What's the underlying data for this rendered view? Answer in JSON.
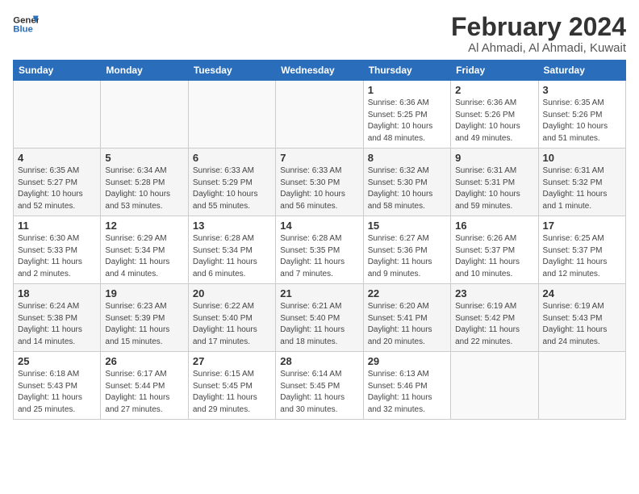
{
  "logo": {
    "line1": "General",
    "line2": "Blue"
  },
  "title": "February 2024",
  "location": "Al Ahmadi, Al Ahmadi, Kuwait",
  "days_of_week": [
    "Sunday",
    "Monday",
    "Tuesday",
    "Wednesday",
    "Thursday",
    "Friday",
    "Saturday"
  ],
  "weeks": [
    [
      {
        "day": "",
        "detail": ""
      },
      {
        "day": "",
        "detail": ""
      },
      {
        "day": "",
        "detail": ""
      },
      {
        "day": "",
        "detail": ""
      },
      {
        "day": "1",
        "detail": "Sunrise: 6:36 AM\nSunset: 5:25 PM\nDaylight: 10 hours\nand 48 minutes."
      },
      {
        "day": "2",
        "detail": "Sunrise: 6:36 AM\nSunset: 5:26 PM\nDaylight: 10 hours\nand 49 minutes."
      },
      {
        "day": "3",
        "detail": "Sunrise: 6:35 AM\nSunset: 5:26 PM\nDaylight: 10 hours\nand 51 minutes."
      }
    ],
    [
      {
        "day": "4",
        "detail": "Sunrise: 6:35 AM\nSunset: 5:27 PM\nDaylight: 10 hours\nand 52 minutes."
      },
      {
        "day": "5",
        "detail": "Sunrise: 6:34 AM\nSunset: 5:28 PM\nDaylight: 10 hours\nand 53 minutes."
      },
      {
        "day": "6",
        "detail": "Sunrise: 6:33 AM\nSunset: 5:29 PM\nDaylight: 10 hours\nand 55 minutes."
      },
      {
        "day": "7",
        "detail": "Sunrise: 6:33 AM\nSunset: 5:30 PM\nDaylight: 10 hours\nand 56 minutes."
      },
      {
        "day": "8",
        "detail": "Sunrise: 6:32 AM\nSunset: 5:30 PM\nDaylight: 10 hours\nand 58 minutes."
      },
      {
        "day": "9",
        "detail": "Sunrise: 6:31 AM\nSunset: 5:31 PM\nDaylight: 10 hours\nand 59 minutes."
      },
      {
        "day": "10",
        "detail": "Sunrise: 6:31 AM\nSunset: 5:32 PM\nDaylight: 11 hours\nand 1 minute."
      }
    ],
    [
      {
        "day": "11",
        "detail": "Sunrise: 6:30 AM\nSunset: 5:33 PM\nDaylight: 11 hours\nand 2 minutes."
      },
      {
        "day": "12",
        "detail": "Sunrise: 6:29 AM\nSunset: 5:34 PM\nDaylight: 11 hours\nand 4 minutes."
      },
      {
        "day": "13",
        "detail": "Sunrise: 6:28 AM\nSunset: 5:34 PM\nDaylight: 11 hours\nand 6 minutes."
      },
      {
        "day": "14",
        "detail": "Sunrise: 6:28 AM\nSunset: 5:35 PM\nDaylight: 11 hours\nand 7 minutes."
      },
      {
        "day": "15",
        "detail": "Sunrise: 6:27 AM\nSunset: 5:36 PM\nDaylight: 11 hours\nand 9 minutes."
      },
      {
        "day": "16",
        "detail": "Sunrise: 6:26 AM\nSunset: 5:37 PM\nDaylight: 11 hours\nand 10 minutes."
      },
      {
        "day": "17",
        "detail": "Sunrise: 6:25 AM\nSunset: 5:37 PM\nDaylight: 11 hours\nand 12 minutes."
      }
    ],
    [
      {
        "day": "18",
        "detail": "Sunrise: 6:24 AM\nSunset: 5:38 PM\nDaylight: 11 hours\nand 14 minutes."
      },
      {
        "day": "19",
        "detail": "Sunrise: 6:23 AM\nSunset: 5:39 PM\nDaylight: 11 hours\nand 15 minutes."
      },
      {
        "day": "20",
        "detail": "Sunrise: 6:22 AM\nSunset: 5:40 PM\nDaylight: 11 hours\nand 17 minutes."
      },
      {
        "day": "21",
        "detail": "Sunrise: 6:21 AM\nSunset: 5:40 PM\nDaylight: 11 hours\nand 18 minutes."
      },
      {
        "day": "22",
        "detail": "Sunrise: 6:20 AM\nSunset: 5:41 PM\nDaylight: 11 hours\nand 20 minutes."
      },
      {
        "day": "23",
        "detail": "Sunrise: 6:19 AM\nSunset: 5:42 PM\nDaylight: 11 hours\nand 22 minutes."
      },
      {
        "day": "24",
        "detail": "Sunrise: 6:19 AM\nSunset: 5:43 PM\nDaylight: 11 hours\nand 24 minutes."
      }
    ],
    [
      {
        "day": "25",
        "detail": "Sunrise: 6:18 AM\nSunset: 5:43 PM\nDaylight: 11 hours\nand 25 minutes."
      },
      {
        "day": "26",
        "detail": "Sunrise: 6:17 AM\nSunset: 5:44 PM\nDaylight: 11 hours\nand 27 minutes."
      },
      {
        "day": "27",
        "detail": "Sunrise: 6:15 AM\nSunset: 5:45 PM\nDaylight: 11 hours\nand 29 minutes."
      },
      {
        "day": "28",
        "detail": "Sunrise: 6:14 AM\nSunset: 5:45 PM\nDaylight: 11 hours\nand 30 minutes."
      },
      {
        "day": "29",
        "detail": "Sunrise: 6:13 AM\nSunset: 5:46 PM\nDaylight: 11 hours\nand 32 minutes."
      },
      {
        "day": "",
        "detail": ""
      },
      {
        "day": "",
        "detail": ""
      }
    ]
  ]
}
